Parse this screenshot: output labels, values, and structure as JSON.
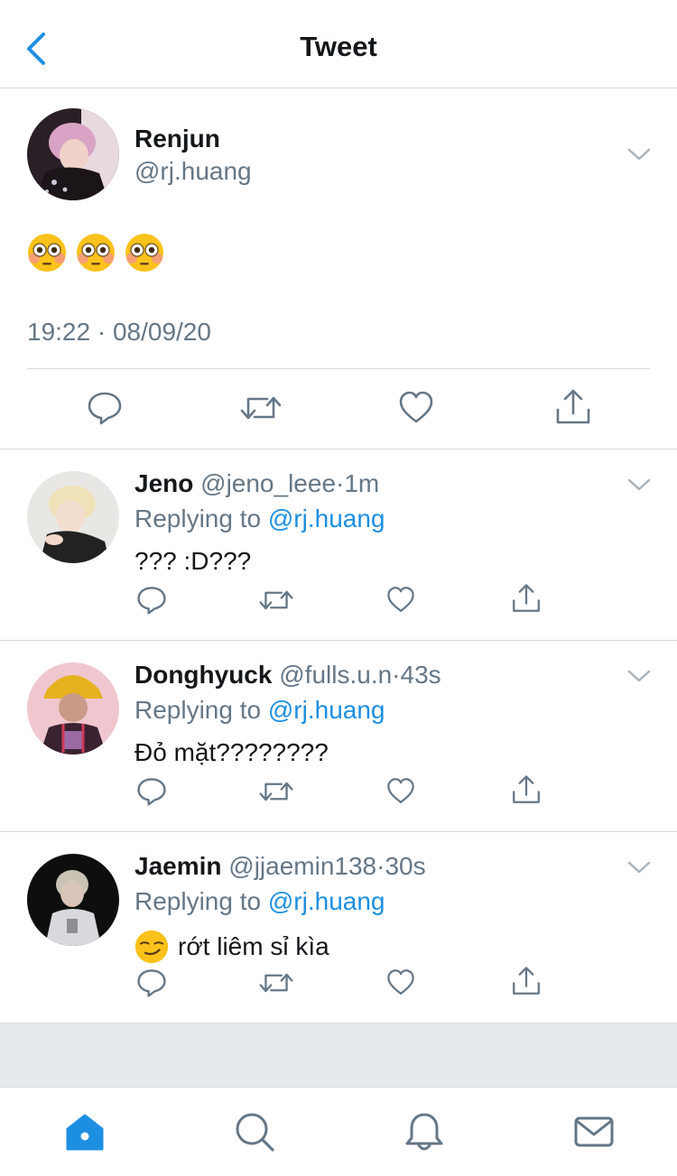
{
  "header": {
    "title": "Tweet"
  },
  "main_tweet": {
    "name": "Renjun",
    "handle": "@rj.huang",
    "emojis": [
      "flushed-face",
      "flushed-face",
      "flushed-face"
    ],
    "timestamp": "19:22 · 08/09/20"
  },
  "replies": [
    {
      "name": "Jeno",
      "handle": "@jeno_leee",
      "time": "1m",
      "replying_prefix": "Replying to",
      "replying_to": "@rj.huang",
      "text": "??? :D???"
    },
    {
      "name": "Donghyuck",
      "handle": "@fulls.u.n",
      "time": "43s",
      "replying_prefix": "Replying to",
      "replying_to": "@rj.huang",
      "text": "Đỏ mặt????????"
    },
    {
      "name": "Jaemin",
      "handle": "@jjaemin138",
      "time": "30s",
      "replying_prefix": "Replying to",
      "replying_to": "@rj.huang",
      "text": "rớt liêm sỉ kìa",
      "emoji": "smirking-face"
    }
  ],
  "separator": "·",
  "tabs": [
    "home",
    "search",
    "notifications",
    "messages"
  ],
  "colors": {
    "accent": "#1d8fe1",
    "muted": "#657786",
    "icon": "#657786",
    "divider": "#d6dadd",
    "band": "#e6e9ec"
  }
}
